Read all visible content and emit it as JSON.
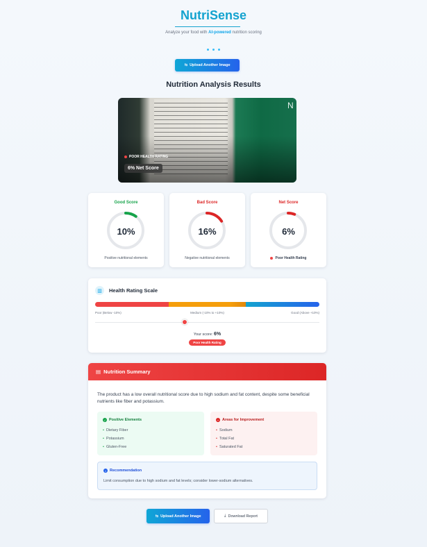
{
  "header": {
    "brand": "NutriSense",
    "tagline_prefix": "Analyze your food with ",
    "tagline_highlight": "AI-powered",
    "tagline_suffix": " nutrition scoring"
  },
  "actions": {
    "upload_label": "Upload Another Image",
    "download_label": "Download Report"
  },
  "results": {
    "title": "Nutrition Analysis Results",
    "photo": {
      "rating_tag": "POOR HEALTH RATING",
      "net_score_label": "6% Net Score",
      "corner_text": "N"
    }
  },
  "scores": [
    {
      "title": "Good Score",
      "value": "10%",
      "caption": "Positive nutritional elements",
      "color": "#16a34a",
      "percent": 10
    },
    {
      "title": "Bad Score",
      "value": "16%",
      "caption": "Negative nutritional elements",
      "color": "#dc2626",
      "percent": 16
    },
    {
      "title": "Net Score",
      "value": "6%",
      "caption": "Poor Health Rating",
      "color": "#dc2626",
      "percent": 6
    }
  ],
  "scale": {
    "title": "Health Rating Scale",
    "label_poor": "Poor (Below -10%)",
    "label_medium": "Medium (-10% to +10%)",
    "label_good": "Good (Above +10%)",
    "your_score_label": "Your score:",
    "your_score_value": "6%",
    "rating": "Poor Health Rating"
  },
  "summary": {
    "title": "Nutrition Summary",
    "text": "The product has a low overall nutritional score due to high sodium and fat content, despite some beneficial nutrients like fiber and potassium.",
    "positive_title": "Positive Elements",
    "positive_items": [
      "Dietary Fiber",
      "Potassium",
      "Gluten-Free"
    ],
    "improve_title": "Areas for Improvement",
    "improve_items": [
      "Sodium",
      "Total Fat",
      "Saturated Fat"
    ],
    "recommendation_title": "Recommendation",
    "recommendation_text": "Limit consumption due to high sodium and fat levels; consider lower-sodium alternatives."
  },
  "colors": {
    "brand": "#14a3cf",
    "primary_button": "#2563eb",
    "poor": "#ef4444",
    "medium": "#f59e0b",
    "good": "#0ea5e9"
  }
}
